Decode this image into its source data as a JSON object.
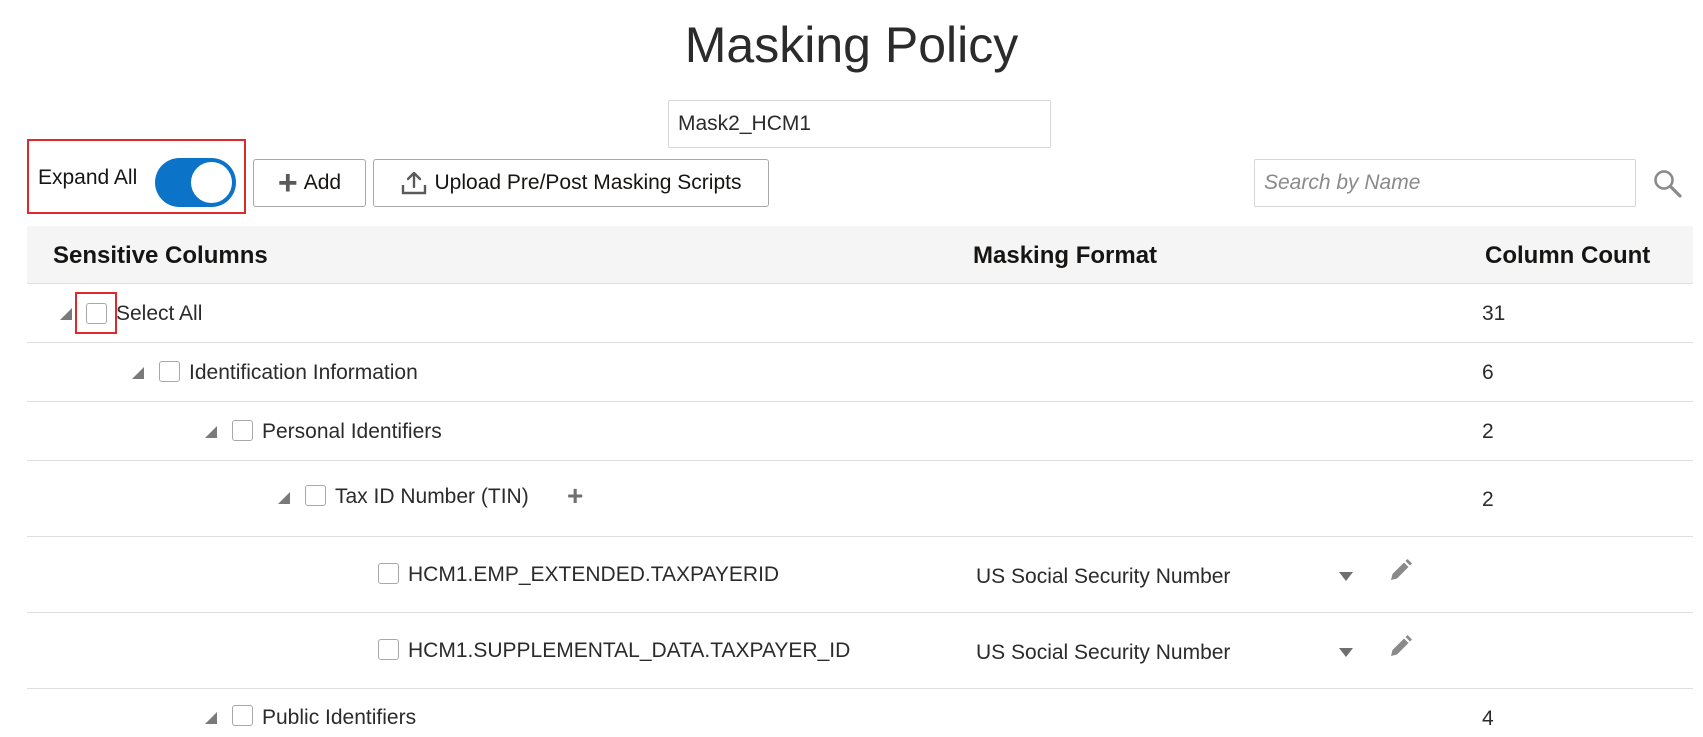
{
  "page": {
    "title": "Masking Policy"
  },
  "policy": {
    "name": "Mask2_HCM1"
  },
  "toolbar": {
    "expand_all_label": "Expand All",
    "expand_all_on": true,
    "add_label": "Add",
    "upload_label": "Upload Pre/Post Masking Scripts",
    "search_placeholder": "Search by Name",
    "accent_color": "#0b74c9",
    "highlight_color": "#e0292b",
    "icons": {
      "add": "plus-icon",
      "upload": "upload-icon",
      "search": "search-icon"
    }
  },
  "table": {
    "headers": {
      "sensitive_columns": "Sensitive Columns",
      "masking_format": "Masking Format",
      "column_count": "Column Count"
    },
    "rows": [
      {
        "label": "Select All",
        "count": "31",
        "format": "",
        "level": 0,
        "expanded": true,
        "checked": false
      },
      {
        "label": "Identification Information",
        "count": "6",
        "format": "",
        "level": 1,
        "expanded": true,
        "checked": false
      },
      {
        "label": "Personal Identifiers",
        "count": "2",
        "format": "",
        "level": 2,
        "expanded": true,
        "checked": false
      },
      {
        "label": "Tax ID Number (TIN)",
        "count": "2",
        "format": "",
        "level": 3,
        "expanded": true,
        "checked": false
      },
      {
        "label": "HCM1.EMP_EXTENDED.TAXPAYERID",
        "count": "",
        "format": "US Social Security Number",
        "level": 4,
        "checked": false
      },
      {
        "label": "HCM1.SUPPLEMENTAL_DATA.TAXPAYER_ID",
        "count": "",
        "format": "US Social Security Number",
        "level": 4,
        "checked": false
      },
      {
        "label": "Public Identifiers",
        "count": "4",
        "format": "",
        "level": 2,
        "expanded": true,
        "checked": false
      }
    ]
  }
}
